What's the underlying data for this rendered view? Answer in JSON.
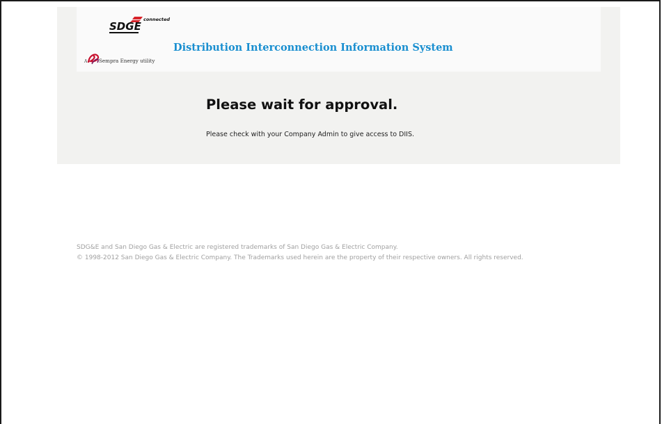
{
  "header": {
    "logo_brand": "SDGE",
    "logo_tagline": "connected",
    "logo_parent_prefix": "A",
    "logo_parent": "Sempra Energy utility",
    "system_title": "Distribution Interconnection Information System"
  },
  "main": {
    "heading": "Please wait for approval.",
    "message": "Please check with your Company Admin to give access to DIIS."
  },
  "footer": {
    "line1": "SDG&E and San Diego Gas & Electric are registered trademarks of San Diego Gas & Electric Company.",
    "line2": "© 1998-2012 San Diego Gas & Electric Company. The Trademarks used herein are the property of their respective owners. All rights reserved."
  },
  "colors": {
    "title_blue": "#1a8fd0",
    "brand_red": "#d8232a",
    "panel_bg": "#f2f2f0",
    "footer_gray": "#a0a0a0"
  }
}
